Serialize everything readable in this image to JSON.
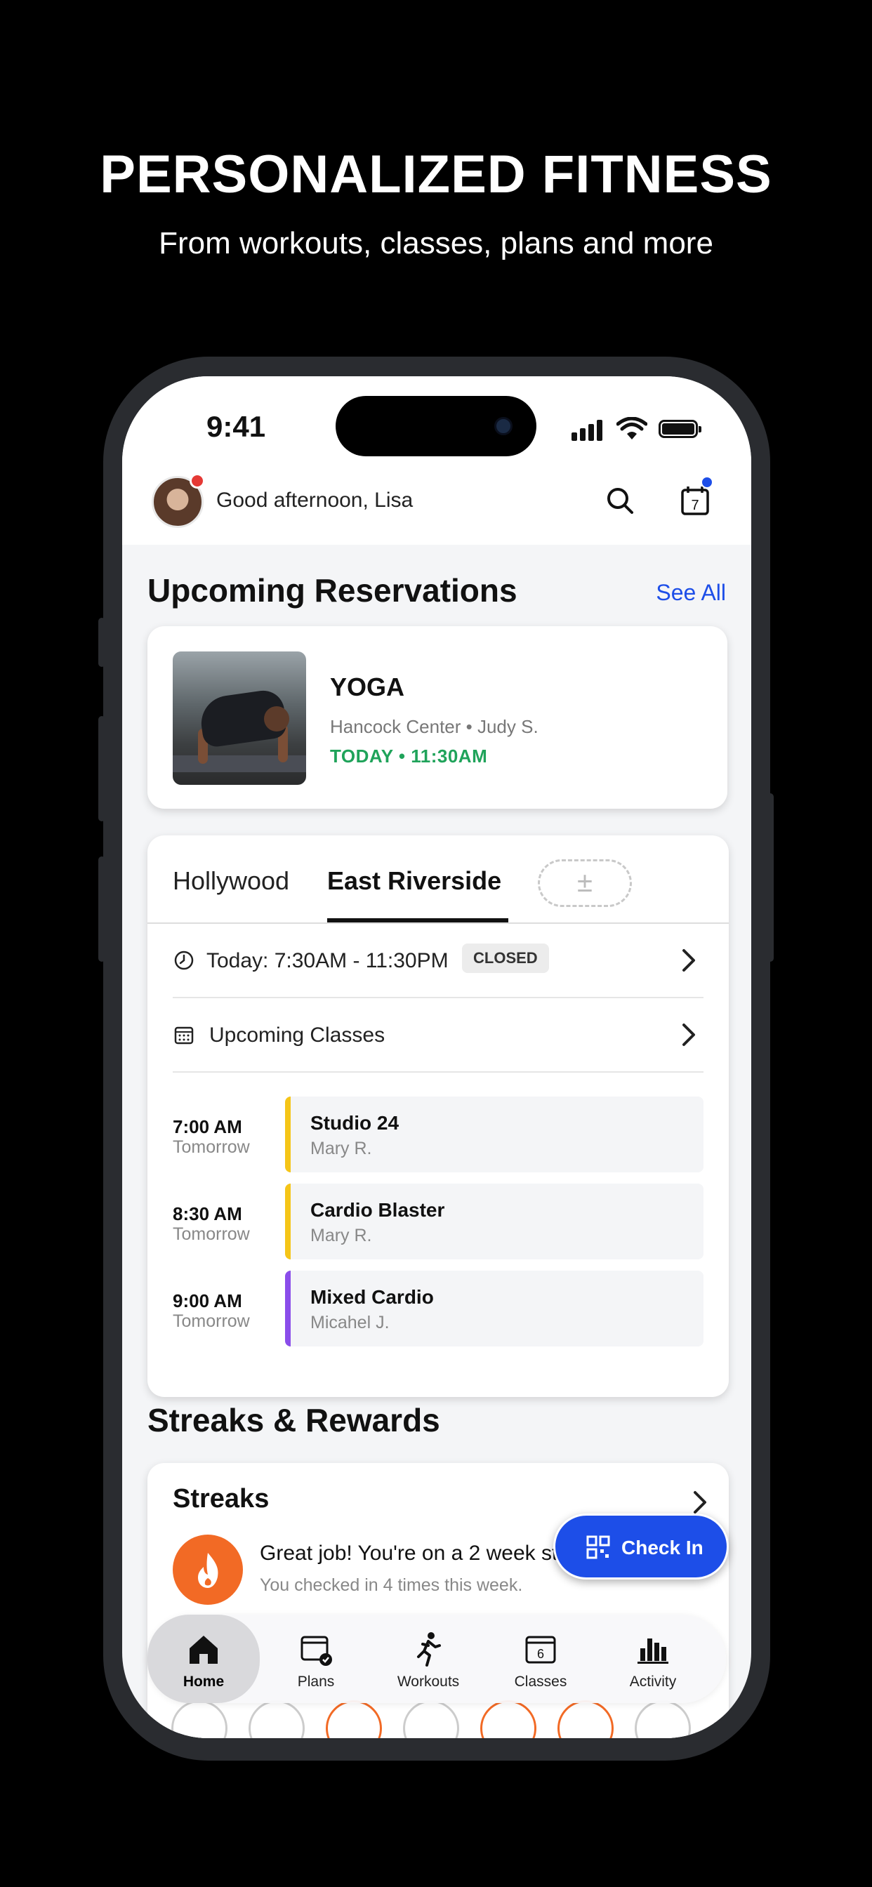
{
  "promo": {
    "headline": "PERSONALIZED FITNESS",
    "subhead": "From workouts, classes, plans and more"
  },
  "status_bar": {
    "time": "9:41"
  },
  "header": {
    "greeting": "Good afternoon, Lisa",
    "calendar_day": "7"
  },
  "reservations": {
    "title": "Upcoming Reservations",
    "see_all": "See All",
    "item": {
      "title": "YOGA",
      "location_instructor": "Hancock Center • Judy S.",
      "when": "TODAY • 11:30AM"
    }
  },
  "locations": {
    "tabs": [
      {
        "label": "Hollywood",
        "active": false
      },
      {
        "label": "East Riverside",
        "active": true
      }
    ],
    "add_tab_symbol": "±",
    "hours": "Today: 7:30AM - 11:30PM",
    "hours_status": "CLOSED",
    "upcoming_label": "Upcoming Classes",
    "classes": [
      {
        "time": "7:00 AM",
        "day": "Tomorrow",
        "name": "Studio 24",
        "instructor": "Mary R.",
        "color": "#f5c518"
      },
      {
        "time": "8:30 AM",
        "day": "Tomorrow",
        "name": "Cardio Blaster",
        "instructor": "Mary R.",
        "color": "#f5c518"
      },
      {
        "time": "9:00 AM",
        "day": "Tomorrow",
        "name": "Mixed Cardio",
        "instructor": "Micahel J.",
        "color": "#8a4dea"
      }
    ]
  },
  "rewards": {
    "title": "Streaks & Rewards",
    "streaks_title": "Streaks",
    "message": "Great job! You're on a 2 week st",
    "sub": "You checked in 4 times this week."
  },
  "checkin": {
    "label": "Check In"
  },
  "nav": {
    "items": [
      {
        "label": "Home",
        "icon": "home-icon",
        "active": true
      },
      {
        "label": "Plans",
        "icon": "plans-icon",
        "active": false
      },
      {
        "label": "Workouts",
        "icon": "workouts-icon",
        "active": false
      },
      {
        "label": "Classes",
        "icon": "classes-icon",
        "active": false
      },
      {
        "label": "Activity",
        "icon": "activity-icon",
        "active": false
      }
    ]
  },
  "colors": {
    "accent": "#1d4ee8",
    "success": "#1fa35a",
    "flame": "#f26a25"
  }
}
